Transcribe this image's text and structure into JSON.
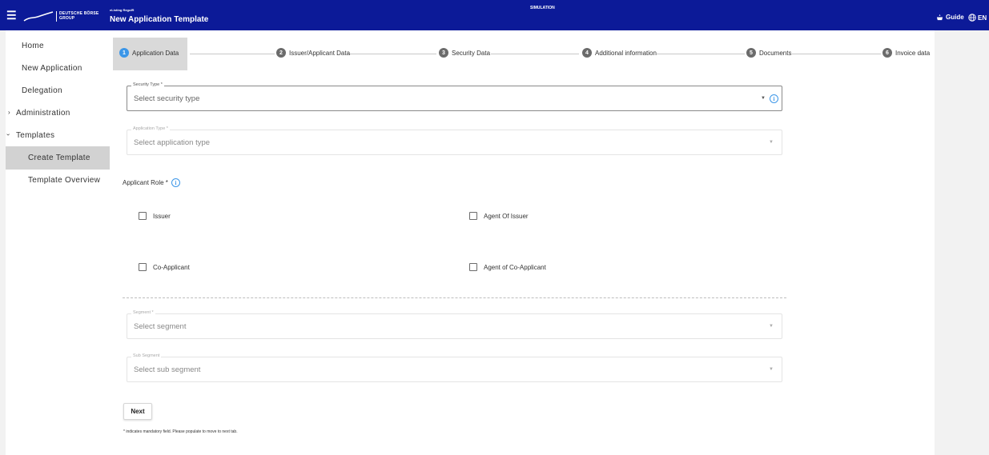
{
  "header": {
    "menu_icon": "hamburger-icon",
    "logo_line1": "DEUTSCHE BÖRSE",
    "logo_line2": "GROUP",
    "breadcrumb": "eListing RegulR",
    "title": "New Application Template",
    "environment": "SIMULATION",
    "guide_label": "Guide",
    "guide_icon": "guide-icon",
    "language": "EN",
    "language_icon": "globe-icon",
    "background_color": "#0c1a98"
  },
  "sidebar": {
    "items": [
      {
        "label": "Home"
      },
      {
        "label": "New Application"
      },
      {
        "label": "Delegation"
      },
      {
        "label": "Administration",
        "chevron": "›"
      },
      {
        "label": "Templates",
        "chevron": "›"
      },
      {
        "label": "Create Template"
      },
      {
        "label": "Template Overview"
      }
    ]
  },
  "stepper": {
    "steps": [
      {
        "num": "1",
        "label": "Application Data"
      },
      {
        "num": "2",
        "label": "Issuer/Applicant Data"
      },
      {
        "num": "3",
        "label": "Security Data"
      },
      {
        "num": "4",
        "label": "Additional information"
      },
      {
        "num": "5",
        "label": "Documents"
      },
      {
        "num": "6",
        "label": "Invoice data"
      }
    ],
    "active_color": "#3b96e8"
  },
  "form": {
    "security_type": {
      "label": "Security Type *",
      "placeholder": "Select security type"
    },
    "application_type": {
      "label": "Application Type *",
      "placeholder": "Select application type"
    },
    "applicant_role_label": "Applicant Role *",
    "roles": {
      "issuer": "Issuer",
      "agent_of_issuer": "Agent Of Issuer",
      "co_applicant": "Co-Applicant",
      "agent_of_co_applicant": "Agent of Co-Applicant"
    },
    "segment": {
      "label": "Segment *",
      "placeholder": "Select segment"
    },
    "sub_segment": {
      "label": "Sub Segment",
      "placeholder": "Select sub segment"
    },
    "next_label": "Next",
    "mandatory_note": "* indicates mandatory field. Please populate to move to next tab."
  }
}
